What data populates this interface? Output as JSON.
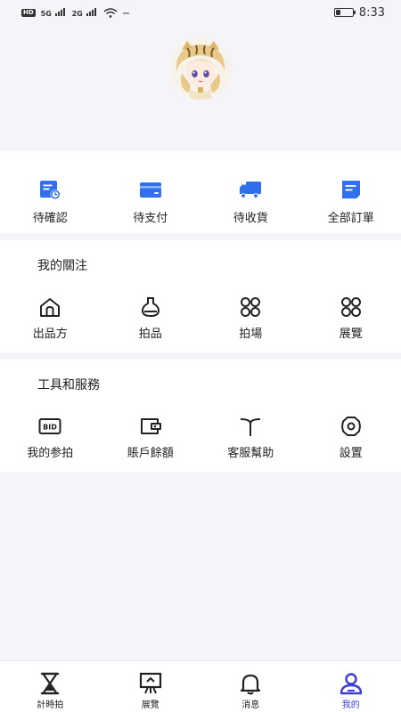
{
  "status_bar": {
    "left_badge": "HD",
    "signal_1": "5G",
    "signal_2": "2G",
    "network_speed": "—",
    "time": "8:33",
    "battery_level": 0.3
  },
  "colors": {
    "accent": "#3b3fcf",
    "order_icon": "#2f6ff0",
    "background": "#f5f5f9"
  },
  "orders": {
    "items": [
      {
        "label": "待確認",
        "icon": "doc-clock-icon"
      },
      {
        "label": "待支付",
        "icon": "card-icon"
      },
      {
        "label": "待收貨",
        "icon": "truck-icon"
      },
      {
        "label": "全部訂單",
        "icon": "order-list-icon"
      }
    ]
  },
  "follow": {
    "title": "我的關注",
    "items": [
      {
        "label": "出品方",
        "icon": "house-icon"
      },
      {
        "label": "拍品",
        "icon": "vase-icon"
      },
      {
        "label": "拍場",
        "icon": "four-circles-icon"
      },
      {
        "label": "展覽",
        "icon": "four-circles-icon"
      }
    ]
  },
  "tools": {
    "title": "工具和服務",
    "items": [
      {
        "label": "我的参拍",
        "icon": "bid-icon",
        "badge": "BID"
      },
      {
        "label": "賬戶餘額",
        "icon": "wallet-icon"
      },
      {
        "label": "客服幫助",
        "icon": "antenna-icon"
      },
      {
        "label": "設置",
        "icon": "gear-icon"
      }
    ]
  },
  "tabbar": {
    "active": 3,
    "items": [
      {
        "label": "計時拍",
        "icon": "hourglass-icon"
      },
      {
        "label": "展覽",
        "icon": "easel-icon"
      },
      {
        "label": "消息",
        "icon": "bell-icon"
      },
      {
        "label": "我的",
        "icon": "person-icon"
      }
    ]
  }
}
